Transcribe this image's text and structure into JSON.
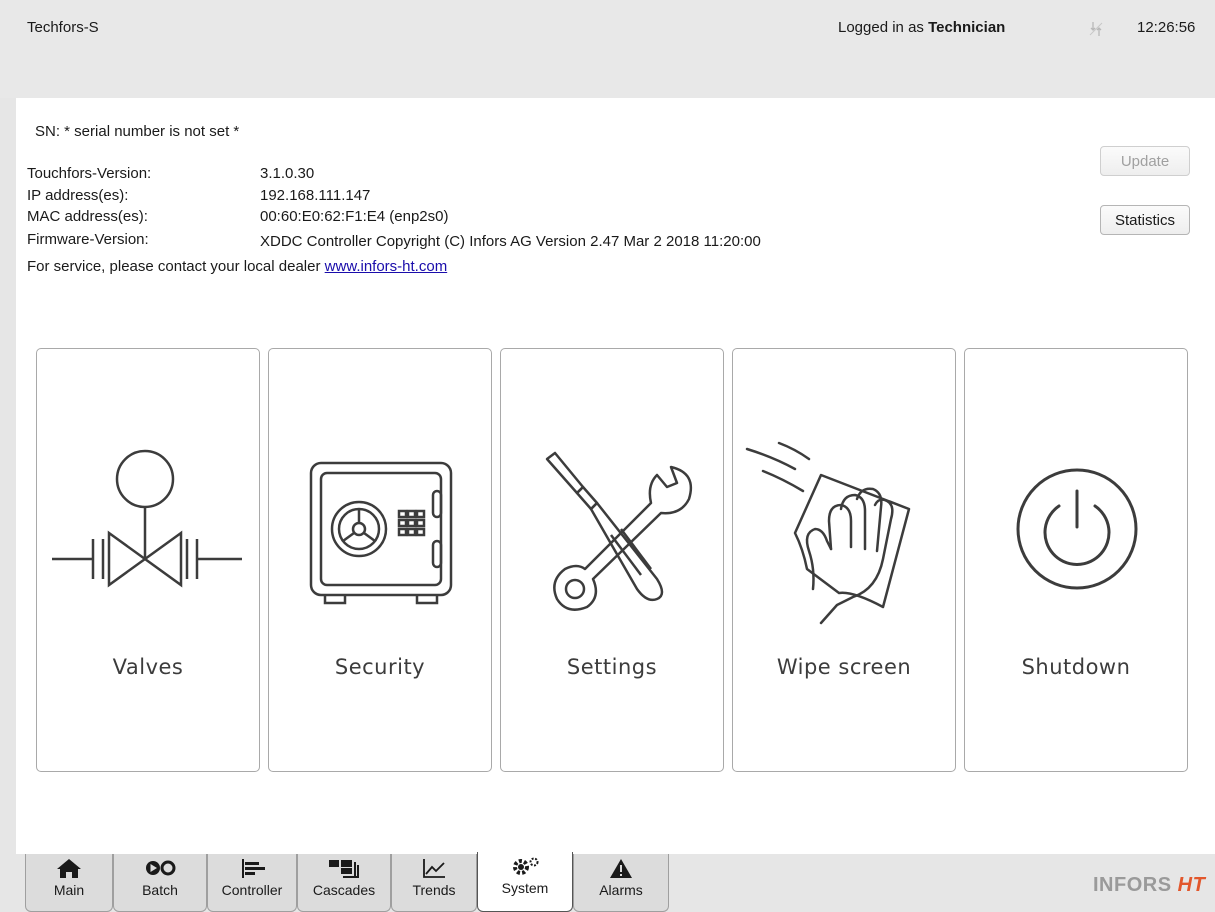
{
  "header": {
    "app_title": "Techfors-S",
    "login_prefix": "Logged in as ",
    "login_user": "Technician",
    "clock": "12:26:56",
    "network_icon": "network-disconnected-icon"
  },
  "info": {
    "serial": "SN: * serial number is not set *",
    "rows": [
      {
        "label": "Touchfors-Version:",
        "value": "3.1.0.30"
      },
      {
        "label": "IP address(es):",
        "value": "192.168.111.147"
      },
      {
        "label": "MAC address(es):",
        "value": "00:60:E0:62:F1:E4 (enp2s0)"
      },
      {
        "label": "Firmware-Version:",
        "value": "XDDC Controller Copyright (C) Infors AG Version 2.47 Mar 2 2018 11:20:00"
      }
    ],
    "service_text": "For service, please contact your local dealer ",
    "service_link": "www.infors-ht.com"
  },
  "buttons": {
    "update": "Update",
    "statistics": "Statistics"
  },
  "tiles": [
    {
      "label": "Valves",
      "icon": "valve-icon"
    },
    {
      "label": "Security",
      "icon": "safe-icon"
    },
    {
      "label": "Settings",
      "icon": "tools-icon"
    },
    {
      "label": "Wipe screen",
      "icon": "wipe-hand-icon"
    },
    {
      "label": "Shutdown",
      "icon": "power-icon"
    }
  ],
  "tabs": [
    {
      "label": "Main",
      "icon": "home-icon"
    },
    {
      "label": "Batch",
      "icon": "batch-icon"
    },
    {
      "label": "Controller",
      "icon": "controller-bars-icon"
    },
    {
      "label": "Cascades",
      "icon": "cascades-icon"
    },
    {
      "label": "Trends",
      "icon": "trend-chart-icon"
    },
    {
      "label": "System",
      "icon": "gears-icon",
      "active": true
    },
    {
      "label": "Alarms",
      "icon": "alarm-warning-icon"
    }
  ],
  "logo": {
    "text": "INFORS ",
    "accent": "HT"
  },
  "colors": {
    "link": "#1a0dab",
    "logo_accent": "#e2572c",
    "icon_stroke": "#3c3c3c"
  }
}
